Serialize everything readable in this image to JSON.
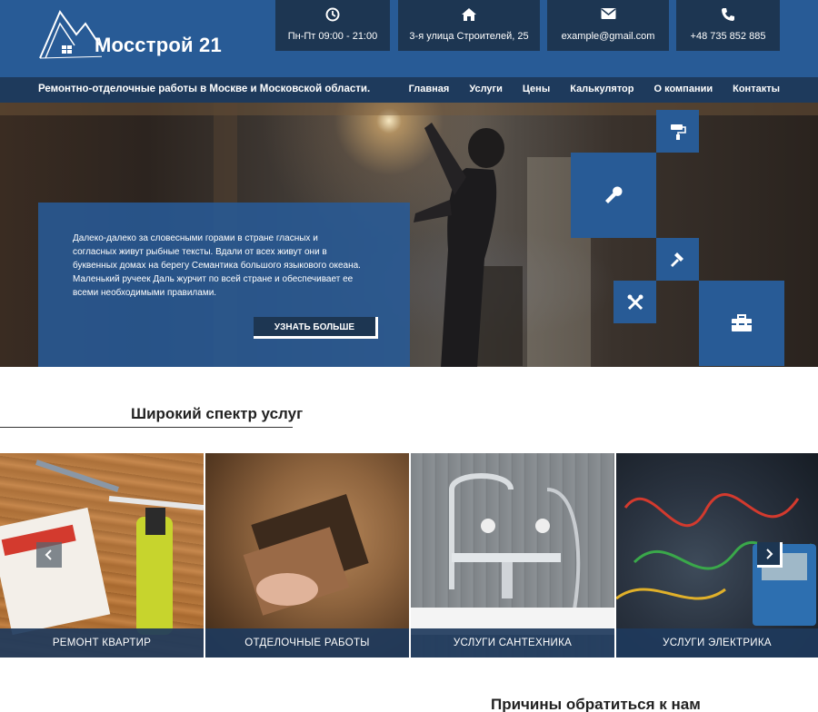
{
  "header": {
    "logo_text": "Мосстрой 21",
    "info": [
      {
        "icon": "clock-icon",
        "text": "Пн-Пт 09:00 - 21:00"
      },
      {
        "icon": "home-icon",
        "text": "3-я улица Строителей, 25"
      },
      {
        "icon": "envelope-icon",
        "text": "example@gmail.com"
      },
      {
        "icon": "phone-icon",
        "text": "+48 735 852 885"
      }
    ],
    "tagline": "Ремонтно-отделочные работы в Москве и Московской области.",
    "menu": [
      "Главная",
      "Услуги",
      "Цены",
      "Калькулятор",
      "О компании",
      "Контакты"
    ]
  },
  "hero": {
    "text": "Далеко-далеко за словесными горами в стране гласных и согласных живут рыбные тексты. Вдали от всех живут они в буквенных домах на берегу Семантика большого языкового океана. Маленький ручеек Даль журчит по всей стране и обеспечивает ее всеми необходимыми правилами.",
    "button": "УЗНАТЬ БОЛЬШЕ",
    "tiles": [
      "paint-roller-icon",
      "wrench-icon",
      "hammer-icon",
      "tools-icon",
      "toolbox-icon"
    ]
  },
  "services": {
    "title": "Широкий спектр услуг",
    "cards": [
      "РЕМОНТ КВАРТИР",
      "ОТДЕЛОЧНЫЕ РАБОТЫ",
      "УСЛУГИ САНТЕХНИКА",
      "УСЛУГИ ЭЛЕКТРИКА"
    ]
  },
  "reasons": {
    "title": "Причины обратиться к нам"
  },
  "colors": {
    "primary": "#285b96",
    "dark": "#1d3652",
    "nav": "#1e3a5c"
  }
}
